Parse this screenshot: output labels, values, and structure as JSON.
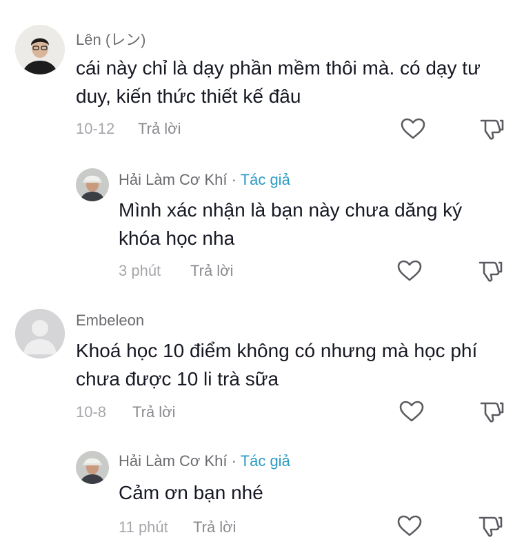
{
  "comments": [
    {
      "name": "Lên (レン)",
      "text": "cái này chỉ là dạy phần mềm thôi mà. có dạy tư duy, kiến thức thiết kế đâu",
      "time": "10-12",
      "reply": "Trả lời",
      "icons": {
        "avatar": "person-photo",
        "like": "heart-outline-icon",
        "dislike": "thumbs-down-outline-icon"
      }
    },
    {
      "name": "Hải Làm Cơ Khí",
      "author_tag": "Tác giả",
      "separator": "·",
      "text": "Mình xác nhận là bạn này chưa dăng ký khóa học nha",
      "time": "3 phút",
      "reply": "Trả lời"
    },
    {
      "name": "Embeleon",
      "text": "Khoá học 10 điểm không có nhưng mà học phí chưa được 10 li trà sữa",
      "time": "10-8",
      "reply": "Trả lời"
    },
    {
      "name": "Hải Làm Cơ Khí",
      "author_tag": "Tác giả",
      "separator": "·",
      "text": "Cảm ơn bạn nhé",
      "time": "11 phút",
      "reply": "Trả lời"
    }
  ],
  "colors": {
    "author_tag": "#2b9bc4",
    "username": "#6b6b70",
    "comment_text": "#161823",
    "meta": "#a6a6ab",
    "icon": "#5a5a60"
  }
}
